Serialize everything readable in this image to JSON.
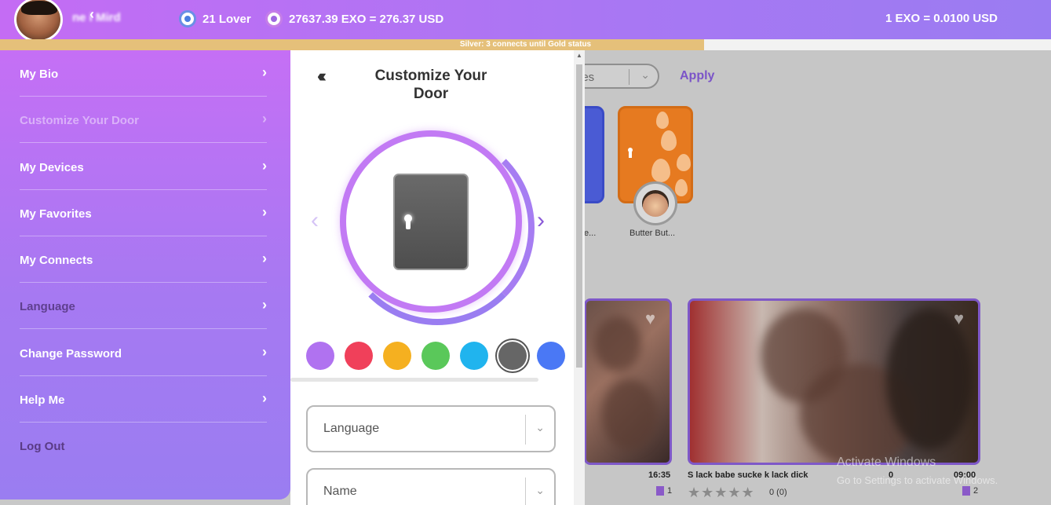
{
  "header": {
    "username": "ne i Mird",
    "lover_count": "21 Lover",
    "exo_balance": "27637.39 EXO = 276.37 USD",
    "exchange_rate": "1 EXO = 0.0100 USD"
  },
  "status_bar": {
    "text": "Silver: 3 connects until Gold status",
    "progress_fraction": 0.67
  },
  "sidebar": {
    "items": [
      {
        "label": "My Bio"
      },
      {
        "label": "Customize Your Door"
      },
      {
        "label": "My Devices"
      },
      {
        "label": "My Favorites"
      },
      {
        "label": "My Connects"
      },
      {
        "label": "Language"
      },
      {
        "label": "Change Password"
      },
      {
        "label": "Help Me"
      },
      {
        "label": "Log Out"
      }
    ]
  },
  "panel": {
    "title": "Customize Your Door",
    "swatch_colors": [
      "#b072f0",
      "#f0405a",
      "#f5b020",
      "#5ac85a",
      "#20b4ee",
      "#666666",
      "#4a78f5"
    ],
    "selected_swatch_index": 5,
    "fields": {
      "language_placeholder": "Language",
      "name_placeholder": "Name"
    }
  },
  "background": {
    "filter_text": "ies",
    "apply_label": "Apply",
    "cards": [
      {
        "label": "e..."
      },
      {
        "label": "Butter But..."
      }
    ],
    "videos": [
      {
        "duration": "16:35",
        "count": "1"
      },
      {
        "title": "S    lack babe sucke  k   lack dick",
        "views": "0",
        "duration": "09:00",
        "rating_text": "0 (0)",
        "count": "2"
      }
    ],
    "watermark_line1": "Activate Windows",
    "watermark_line2": "Go to Settings to activate Windows."
  },
  "colors": {
    "accent_purple": "#c46cf4",
    "accent_violet": "#9a7cf2",
    "status_gold": "#e5c07a"
  }
}
